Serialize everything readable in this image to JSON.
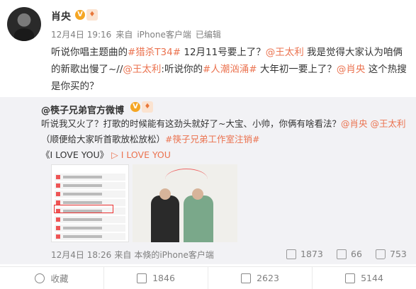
{
  "post": {
    "author": "肖央",
    "date": "12月4日 19:16",
    "source_prefix": "来自",
    "source": "iPhone客户端",
    "edited": "已编辑",
    "text_parts": [
      {
        "t": "听说你唱主题曲的",
        "link": false
      },
      {
        "t": "#猎杀T34#",
        "link": true
      },
      {
        "t": " 12月11号要上了？",
        "link": false
      },
      {
        "t": "@王太利",
        "link": true
      },
      {
        "t": "  我是觉得大家认为咱俩的新歌出慢了~//",
        "link": false
      },
      {
        "t": "@王太利",
        "link": true
      },
      {
        "t": ":听说你的",
        "link": false
      },
      {
        "t": "#人潮汹涌#",
        "link": true
      },
      {
        "t": " 大年初一要上了？",
        "link": false
      },
      {
        "t": "@肖央",
        "link": true
      },
      {
        "t": "  这个热搜是你买的？",
        "link": false
      }
    ]
  },
  "repost": {
    "author": "@筷子兄弟官方微博",
    "text_parts": [
      {
        "t": "听说我又火了？打歌的时候能有这劲头就好了~大宝、小帅，你俩有啥看法？",
        "link": false
      },
      {
        "t": "@肖央",
        "link": true
      },
      {
        "t": " ",
        "link": false
      },
      {
        "t": "@王太利",
        "link": true
      },
      {
        "t": "（顺便给大家听首歌放松放松）",
        "link": false
      },
      {
        "t": "#筷子兄弟工作室注销#",
        "link": true
      }
    ],
    "song_title": "《I LOVE YOU》",
    "song_link": "▷ I LOVE YOU",
    "date": "12月4日 18:26",
    "source_prefix": "来自",
    "source": "本倏的iPhone客户端",
    "reposts": "1873",
    "comments": "66",
    "likes": "753"
  },
  "actions": {
    "favorite": "收藏",
    "repost": "1846",
    "comment": "2623",
    "like": "5144"
  },
  "icons": {
    "verified": "verified-badge-icon",
    "level": "level-badge-icon",
    "repost": "repost-icon",
    "comment": "comment-icon",
    "like": "thumbs-up-icon",
    "favorite": "star-icon"
  },
  "colors": {
    "link": "#eb7350",
    "repost_bg": "#f2f2f5",
    "muted": "#808080"
  }
}
